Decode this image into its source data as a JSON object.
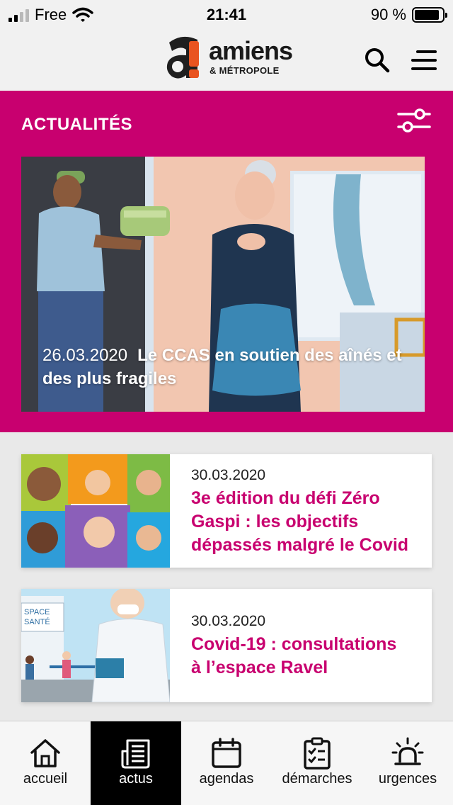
{
  "status_bar": {
    "carrier": "Free",
    "time": "21:41",
    "battery": "90 %",
    "battery_level": 0.9
  },
  "header": {
    "logo_word": "amiens",
    "logo_sub": "& MÉTROPOLE",
    "search_icon": "search-icon",
    "menu_icon": "hamburger-menu-icon"
  },
  "section": {
    "title": "ACTUALITÉS",
    "filter_icon": "filter-sliders-icon"
  },
  "hero": {
    "date": "26.03.2020",
    "title": "Le CCAS en soutien des aînés et des plus fragiles"
  },
  "news": [
    {
      "date": "30.03.2020",
      "title": "3e édition du défi Zéro\nGaspi : les objectifs\ndépassés malgré le Covid"
    },
    {
      "date": "30.03.2020",
      "title": "Covid-19 : consultations\nà l’espace Ravel"
    }
  ],
  "nav": [
    {
      "label": "accueil",
      "icon": "home-icon",
      "active": false
    },
    {
      "label": "actus",
      "icon": "newspaper-icon",
      "active": true
    },
    {
      "label": "agendas",
      "icon": "calendar-icon",
      "active": false
    },
    {
      "label": "démarches",
      "icon": "checklist-icon",
      "active": false
    },
    {
      "label": "urgences",
      "icon": "alarm-light-icon",
      "active": false
    }
  ],
  "colors": {
    "accent": "#c8006f",
    "logo_orange": "#e95420",
    "header_bg": "#f1f1f1"
  }
}
